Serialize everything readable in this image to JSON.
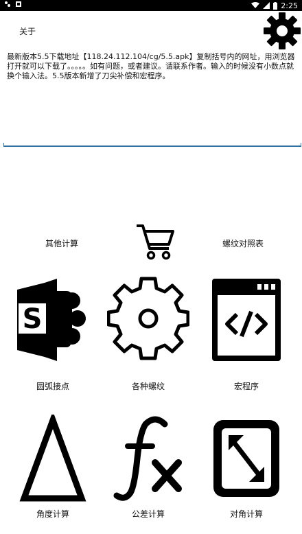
{
  "status_bar": {
    "time": "2:25",
    "left_icons": [
      "app-icon-1",
      "app-icon-2"
    ],
    "right_icons": [
      "wifi-icon",
      "signal-icon",
      "battery-icon"
    ]
  },
  "header": {
    "about_label": "关于",
    "settings_icon": "gear-icon"
  },
  "notice": {
    "text": "最新版本5.5下载地址【118.24.112.104/cg/5.5.apk】复制括号内的网址，用浏览器打开就可以下载了。。。。。如有问题，或者建议。请联系作者。输入的时候没有小数点就换个输入法。5.5版本新增了刀尖补偿和宏程序。"
  },
  "menu": {
    "row1": {
      "other_calc": "其他计算",
      "cart_icon": "cart-icon",
      "thread_table": "螺纹对照表"
    },
    "items": [
      {
        "label": "圆弧接点",
        "icon": "sharepoint-icon"
      },
      {
        "label": "各种螺纹",
        "icon": "gear-icon"
      },
      {
        "label": "宏程序",
        "icon": "code-window-icon"
      },
      {
        "label": "角度计算",
        "icon": "triangle-icon"
      },
      {
        "label": "公差计算",
        "icon": "function-icon"
      },
      {
        "label": "对角计算",
        "icon": "diagonal-resize-icon"
      }
    ]
  }
}
